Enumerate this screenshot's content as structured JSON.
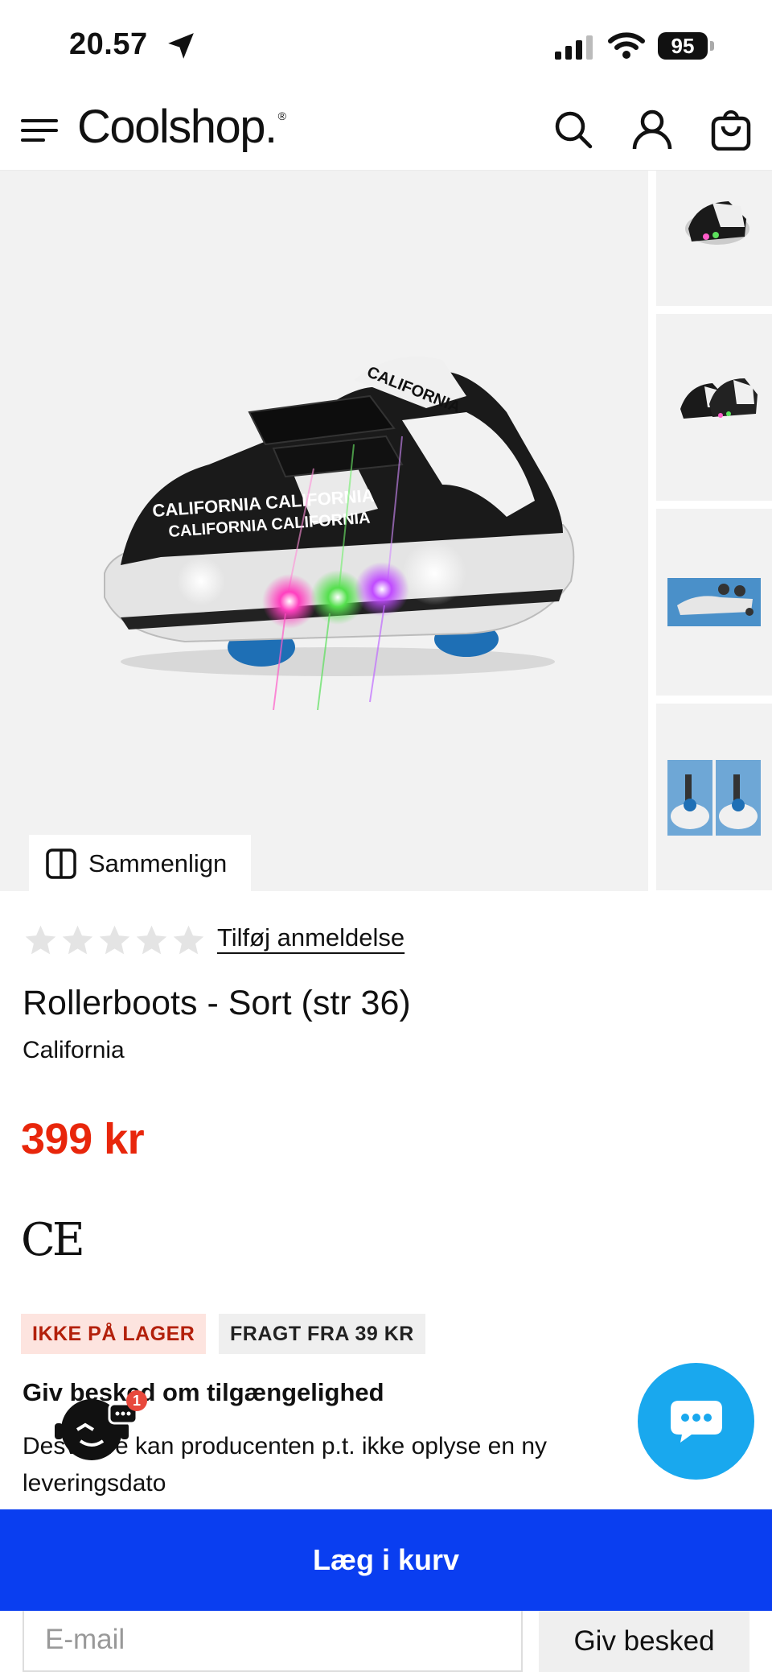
{
  "status_bar": {
    "time": "20.57",
    "battery": "95"
  },
  "header": {
    "logo": "Coolshop."
  },
  "gallery": {
    "compare_label": "Sammenlign"
  },
  "product": {
    "rating_stars": 0,
    "review_link": "Tilføj anmeldelse",
    "title": "Rollerboots - Sort (str 36)",
    "brand": "California",
    "price": "399 kr",
    "certification": "CE",
    "stock_badge": "IKKE PÅ LAGER",
    "shipping_badge": "FRAGT FRA 39 KR",
    "notify_heading": "Giv besked om tilgængelighed",
    "notify_text": "Desværre kan producenten p.t. ikke oplyse en ny leveringsdato"
  },
  "chat": {
    "unread_count": "1"
  },
  "actions": {
    "add_to_cart": "Læg i kurv",
    "email_placeholder": "E-mail",
    "notify_button": "Giv besked"
  },
  "colors": {
    "price": "#e8260b",
    "cta": "#0a3ef0",
    "chat": "#19a8ee"
  }
}
